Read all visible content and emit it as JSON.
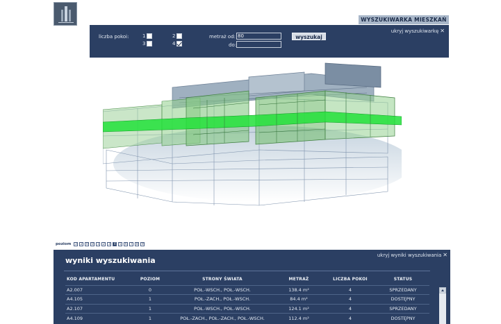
{
  "search": {
    "tab_label": "WYSZUKIWARKA MIESZKAŃ",
    "hide_label": "ukryj wyszukiwarkę",
    "rooms_label": "liczba pokoi:",
    "rooms": [
      {
        "label": "1",
        "checked": false
      },
      {
        "label": "2",
        "checked": false
      },
      {
        "label": "3",
        "checked": false
      },
      {
        "label": "4",
        "checked": true
      }
    ],
    "area_from_label": "metraż od:",
    "area_from_value": "80",
    "area_to_label": "do:",
    "area_to_value": "",
    "search_button": "wyszukaj"
  },
  "floors": {
    "label": "poziom",
    "items": [
      "3",
      "2",
      "0",
      "0",
      "1",
      "2",
      "3",
      "4",
      "5",
      "6",
      "7",
      "8",
      "9"
    ],
    "active_index": 7
  },
  "results": {
    "title": "wyniki wyszukiwania",
    "hide_label": "ukryj wyniki wyszukiwania",
    "columns": [
      "KOD APARTAMENTU",
      "POZIOM",
      "STRONY ŚWIATA",
      "METRAŻ",
      "LICZBA POKOI",
      "STATUS"
    ],
    "rows": [
      [
        "A2.007",
        "0",
        "POŁ.-WSCH., POŁ.-WSCH.",
        "138.4 m²",
        "4",
        "SPRZEDANY"
      ],
      [
        "A4.105",
        "1",
        "POŁ.-ZACH., POŁ.-WSCH.",
        "84.4 m²",
        "4",
        "DOSTĘPNY"
      ],
      [
        "A2.107",
        "1",
        "POŁ.-WSCH., POŁ.-WSCH.",
        "124.1 m²",
        "4",
        "SPRZEDANY"
      ],
      [
        "A4.109",
        "1",
        "POŁ.-ZACH., POŁ.-ZACH., POŁ.-WSCH.",
        "112.4 m²",
        "4",
        "DOSTĘPNY"
      ]
    ]
  },
  "colors": {
    "panel": "#2b3f63",
    "highlight": "#22e03a"
  }
}
